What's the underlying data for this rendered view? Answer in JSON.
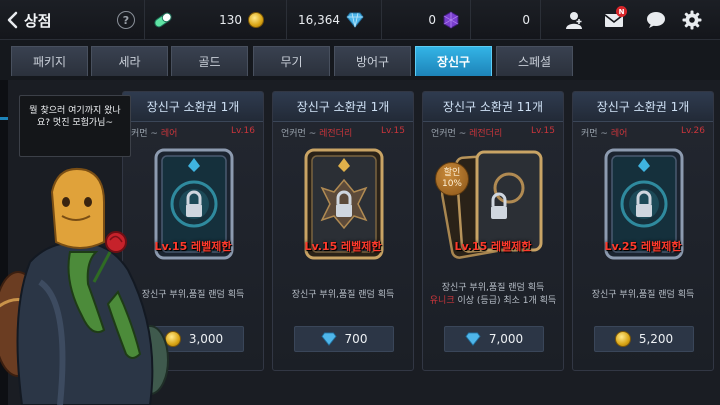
{
  "header": {
    "title": "상점",
    "help_label": "?",
    "currencies": [
      {
        "name": "stamina",
        "icon": "energy-capsule-icon",
        "value": ""
      },
      {
        "name": "gold",
        "icon": "gold-coin-icon",
        "value": "130"
      },
      {
        "name": "diamond",
        "icon": "diamond-icon",
        "value": "16,364"
      },
      {
        "name": "purple_gem",
        "icon": "purple-gem-icon",
        "value": "0"
      },
      {
        "name": "extra",
        "icon": "",
        "value": "0"
      }
    ],
    "mail_badge": "N",
    "icons": [
      "friends-icon",
      "mail-icon",
      "chat-icon",
      "settings-gear-icon"
    ]
  },
  "tabs": [
    {
      "label": "패키지",
      "active": false
    },
    {
      "label": "세라",
      "active": false
    },
    {
      "label": "골드",
      "active": false
    },
    {
      "label": "무기",
      "active": false
    },
    {
      "label": "방어구",
      "active": false
    },
    {
      "label": "장신구",
      "active": true
    },
    {
      "label": "스페셜",
      "active": false
    }
  ],
  "npc": {
    "speech": "뭘 찾으러 여기까지 왔나요? 멋진 모험가님~"
  },
  "cards": [
    {
      "title": "장신구 소환권 1개",
      "grade_label": "커먼",
      "grade_value": "레어",
      "level_range": "Lv.16",
      "level_limit": "Lv.15 레벨제한",
      "desc_line1": "장신구 부위,품질 랜덤 획득",
      "desc_line2_red": "",
      "desc_line2": "",
      "price": "3,000",
      "price_icon": "gold-coin-icon",
      "sale_text": ""
    },
    {
      "title": "장신구 소환권 1개",
      "grade_label": "언커먼",
      "grade_value": "레전더리",
      "level_range": "Lv.15",
      "level_limit": "Lv.15 레벨제한",
      "desc_line1": "장신구 부위,품질 랜덤 획득",
      "desc_line2_red": "",
      "desc_line2": "",
      "price": "700",
      "price_icon": "diamond-icon",
      "sale_text": ""
    },
    {
      "title": "장신구 소환권 11개",
      "grade_label": "언커먼",
      "grade_value": "레전더리",
      "level_range": "Lv.15",
      "level_limit": "Lv.15 레벨제한",
      "desc_line1": "장신구 부위,품질 랜덤 획득",
      "desc_line2_red": "유니크",
      "desc_line2": " 이상 (등급) 최소 1개 획득",
      "price": "7,000",
      "price_icon": "diamond-icon",
      "sale_text": "할인 10%"
    },
    {
      "title": "장신구 소환권 1개",
      "grade_label": "커먼",
      "grade_value": "레어",
      "level_range": "Lv.26",
      "level_limit": "Lv.25 레벨제한",
      "desc_line1": "장신구 부위,품질 랜덤 획득",
      "desc_line2_red": "",
      "desc_line2": "",
      "price": "5,200",
      "price_icon": "gold-coin-icon",
      "sale_text": ""
    }
  ]
}
